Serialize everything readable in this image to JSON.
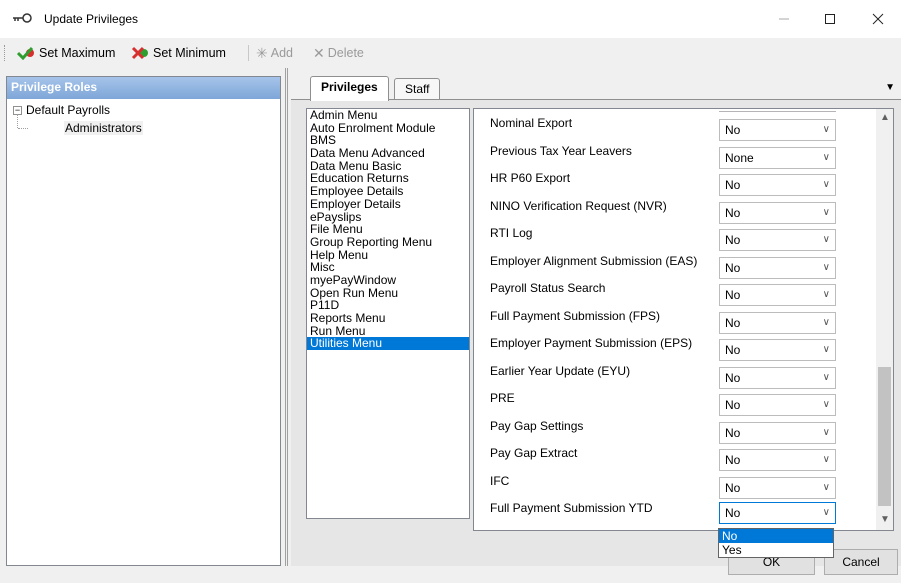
{
  "window": {
    "title": "Update Privileges"
  },
  "toolbar": {
    "set_maximum": "Set Maximum",
    "set_minimum": "Set Minimum",
    "add": "Add",
    "delete": "Delete"
  },
  "left_panel": {
    "header": "Privilege Roles",
    "tree_root": "Default Payrolls",
    "tree_child": "Administrators",
    "toggle_symbol": "−"
  },
  "tabs": [
    "Privileges",
    "Staff"
  ],
  "menus": [
    "Admin Menu",
    "Auto Enrolment Module",
    "BMS",
    "Data Menu Advanced",
    "Data Menu Basic",
    "Education Returns",
    "Employee Details",
    "Employer Details",
    "ePayslips",
    "File Menu",
    "Group Reporting Menu",
    "Help Menu",
    "Misc",
    "myePayWindow",
    "Open Run Menu",
    "P11D",
    "Reports Menu",
    "Run Menu",
    "Utilities Menu"
  ],
  "selected_menu_index": 18,
  "privileges": [
    {
      "label": "Nominal Export",
      "value": "No"
    },
    {
      "label": "Previous Tax Year Leavers",
      "value": "None"
    },
    {
      "label": "HR P60 Export",
      "value": "No"
    },
    {
      "label": "NINO Verification Request (NVR)",
      "value": "No"
    },
    {
      "label": "RTI Log",
      "value": "No"
    },
    {
      "label": "Employer Alignment Submission (EAS)",
      "value": "No"
    },
    {
      "label": "Payroll Status Search",
      "value": "No"
    },
    {
      "label": "Full Payment Submission (FPS)",
      "value": "No"
    },
    {
      "label": "Employer Payment Submission (EPS)",
      "value": "No"
    },
    {
      "label": "Earlier Year Update (EYU)",
      "value": "No"
    },
    {
      "label": "PRE",
      "value": "No"
    },
    {
      "label": "Pay Gap Settings",
      "value": "No"
    },
    {
      "label": "Pay Gap Extract",
      "value": "No"
    },
    {
      "label": "IFC",
      "value": "No"
    },
    {
      "label": "Full Payment Submission YTD",
      "value": "No"
    }
  ],
  "dropdown_options": [
    "No",
    "Yes"
  ],
  "dropdown_selected_index": 0,
  "buttons": {
    "ok": "OK",
    "cancel": "Cancel"
  },
  "colors": {
    "accent": "#0078d7",
    "header_gradient_top": "#a6c4ea",
    "header_gradient_bottom": "#7ea6d8"
  }
}
